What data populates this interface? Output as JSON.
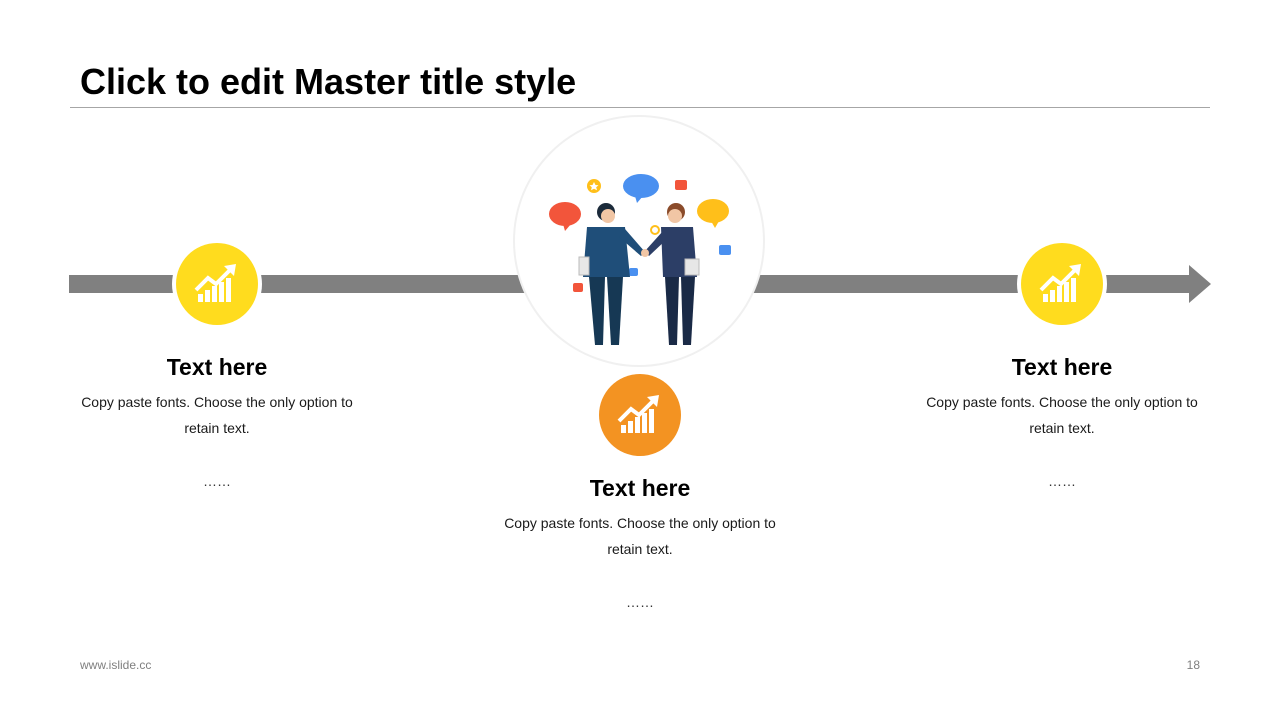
{
  "slide": {
    "title": "Click to edit Master title style",
    "footer_url": "www.islide.cc",
    "page_number": "18"
  },
  "items": [
    {
      "icon": "growth-chart-icon",
      "color": "#FFDC1E",
      "heading": "Text here",
      "body": "Copy paste fonts. Choose the only option to retain text.",
      "dots": "……"
    },
    {
      "icon": "growth-chart-icon",
      "color": "#F39322",
      "heading": "Text here",
      "body": "Copy paste fonts. Choose the only option to retain text.",
      "dots": "……"
    },
    {
      "icon": "growth-chart-icon",
      "color": "#FFDC1E",
      "heading": "Text here",
      "body": "Copy paste fonts. Choose the only option to retain text.",
      "dots": "……"
    }
  ],
  "illustration": {
    "icon": "business-handshake-icon"
  },
  "colors": {
    "arrow": "#808080",
    "yellow": "#FFDC1E",
    "orange": "#F39322"
  }
}
